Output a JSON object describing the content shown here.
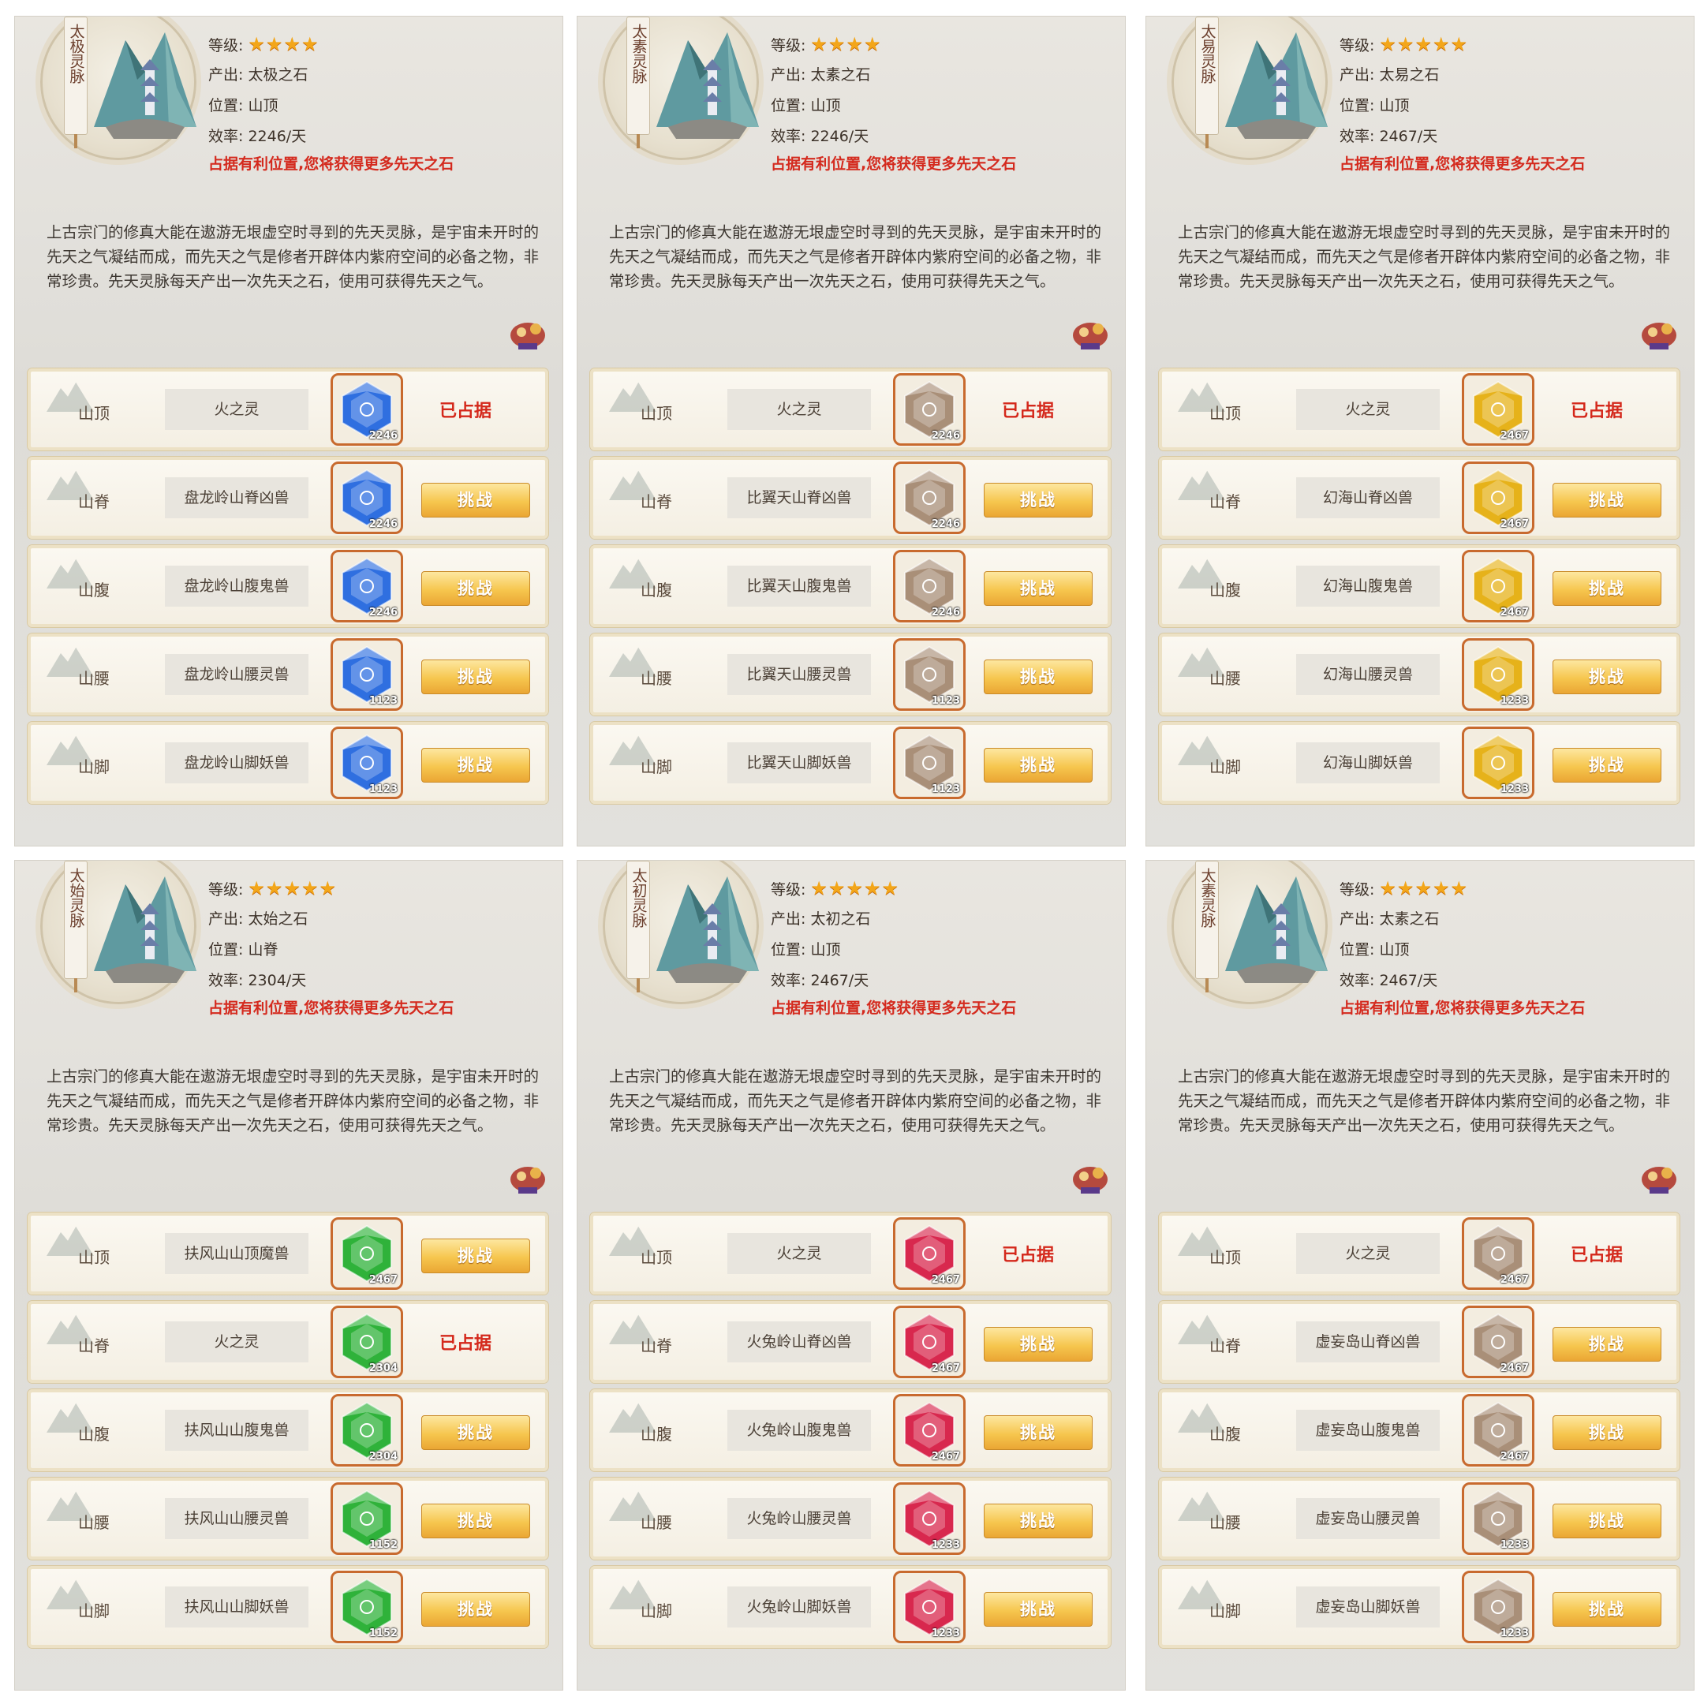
{
  "labels": {
    "level": "等级:",
    "output": "产出:",
    "position": "位置:",
    "efficiency": "效率:",
    "hint": "占据有利位置,您将获得更多先天之石",
    "occupied": "已占据",
    "challenge": "挑战"
  },
  "description": "上古宗门的修真大能在遨游无垠虚空时寻到的先天灵脉，是宇宙未开时的先天之气凝结而成，而先天之气是修者开辟体内紫府空间的必备之物，非常珍贵。先天灵脉每天产出一次先天之石，使用可获得先天之气。",
  "panels": [
    {
      "scroll": "太极灵脉",
      "stars": "★★★★",
      "output": "太极之石",
      "position": "山顶",
      "efficiency": "2246/天",
      "gem_color": "#2f6fe0",
      "slots": [
        {
          "loc": "山顶",
          "name": "火之灵",
          "count": "2246",
          "owned": true
        },
        {
          "loc": "山脊",
          "name": "盘龙岭山脊凶兽",
          "count": "2246",
          "owned": false
        },
        {
          "loc": "山腹",
          "name": "盘龙岭山腹鬼兽",
          "count": "2246",
          "owned": false
        },
        {
          "loc": "山腰",
          "name": "盘龙岭山腰灵兽",
          "count": "1123",
          "owned": false
        },
        {
          "loc": "山脚",
          "name": "盘龙岭山脚妖兽",
          "count": "1123",
          "owned": false
        }
      ]
    },
    {
      "scroll": "太素灵脉",
      "stars": "★★★★",
      "output": "太素之石",
      "position": "山顶",
      "efficiency": "2246/天",
      "gem_color": "#a98f78",
      "slots": [
        {
          "loc": "山顶",
          "name": "火之灵",
          "count": "2246",
          "owned": true
        },
        {
          "loc": "山脊",
          "name": "比翼天山脊凶兽",
          "count": "2246",
          "owned": false
        },
        {
          "loc": "山腹",
          "name": "比翼天山腹鬼兽",
          "count": "2246",
          "owned": false
        },
        {
          "loc": "山腰",
          "name": "比翼天山腰灵兽",
          "count": "1123",
          "owned": false
        },
        {
          "loc": "山脚",
          "name": "比翼天山脚妖兽",
          "count": "1123",
          "owned": false
        }
      ]
    },
    {
      "scroll": "太易灵脉",
      "stars": "★★★★★",
      "output": "太易之石",
      "position": "山顶",
      "efficiency": "2467/天",
      "gem_color": "#e6b21a",
      "slots": [
        {
          "loc": "山顶",
          "name": "火之灵",
          "count": "2467",
          "owned": true
        },
        {
          "loc": "山脊",
          "name": "幻海山脊凶兽",
          "count": "2467",
          "owned": false
        },
        {
          "loc": "山腹",
          "name": "幻海山腹鬼兽",
          "count": "2467",
          "owned": false
        },
        {
          "loc": "山腰",
          "name": "幻海山腰灵兽",
          "count": "1233",
          "owned": false
        },
        {
          "loc": "山脚",
          "name": "幻海山脚妖兽",
          "count": "1233",
          "owned": false
        }
      ]
    },
    {
      "scroll": "太始灵脉",
      "stars": "★★★★★",
      "output": "太始之石",
      "position": "山脊",
      "efficiency": "2304/天",
      "gem_color": "#2fb23a",
      "slots": [
        {
          "loc": "山顶",
          "name": "扶风山山顶魔兽",
          "count": "2467",
          "owned": false
        },
        {
          "loc": "山脊",
          "name": "火之灵",
          "count": "2304",
          "owned": true
        },
        {
          "loc": "山腹",
          "name": "扶风山山腹鬼兽",
          "count": "2304",
          "owned": false
        },
        {
          "loc": "山腰",
          "name": "扶风山山腰灵兽",
          "count": "1152",
          "owned": false
        },
        {
          "loc": "山脚",
          "name": "扶风山山脚妖兽",
          "count": "1152",
          "owned": false
        }
      ]
    },
    {
      "scroll": "太初灵脉",
      "stars": "★★★★★",
      "output": "太初之石",
      "position": "山顶",
      "efficiency": "2467/天",
      "gem_color": "#d8284e",
      "slots": [
        {
          "loc": "山顶",
          "name": "火之灵",
          "count": "2467",
          "owned": true
        },
        {
          "loc": "山脊",
          "name": "火兔岭山脊凶兽",
          "count": "2467",
          "owned": false
        },
        {
          "loc": "山腹",
          "name": "火兔岭山腹鬼兽",
          "count": "2467",
          "owned": false
        },
        {
          "loc": "山腰",
          "name": "火兔岭山腰灵兽",
          "count": "1233",
          "owned": false
        },
        {
          "loc": "山脚",
          "name": "火兔岭山脚妖兽",
          "count": "1233",
          "owned": false
        }
      ]
    },
    {
      "scroll": "太素灵脉",
      "stars": "★★★★★",
      "output": "太素之石",
      "position": "山顶",
      "efficiency": "2467/天",
      "gem_color": "#a98f78",
      "slots": [
        {
          "loc": "山顶",
          "name": "火之灵",
          "count": "2467",
          "owned": true
        },
        {
          "loc": "山脊",
          "name": "虚妄岛山脊凶兽",
          "count": "2467",
          "owned": false
        },
        {
          "loc": "山腹",
          "name": "虚妄岛山腹鬼兽",
          "count": "2467",
          "owned": false
        },
        {
          "loc": "山腰",
          "name": "虚妄岛山腰灵兽",
          "count": "1233",
          "owned": false
        },
        {
          "loc": "山脚",
          "name": "虚妄岛山脚妖兽",
          "count": "1233",
          "owned": false
        }
      ]
    }
  ]
}
